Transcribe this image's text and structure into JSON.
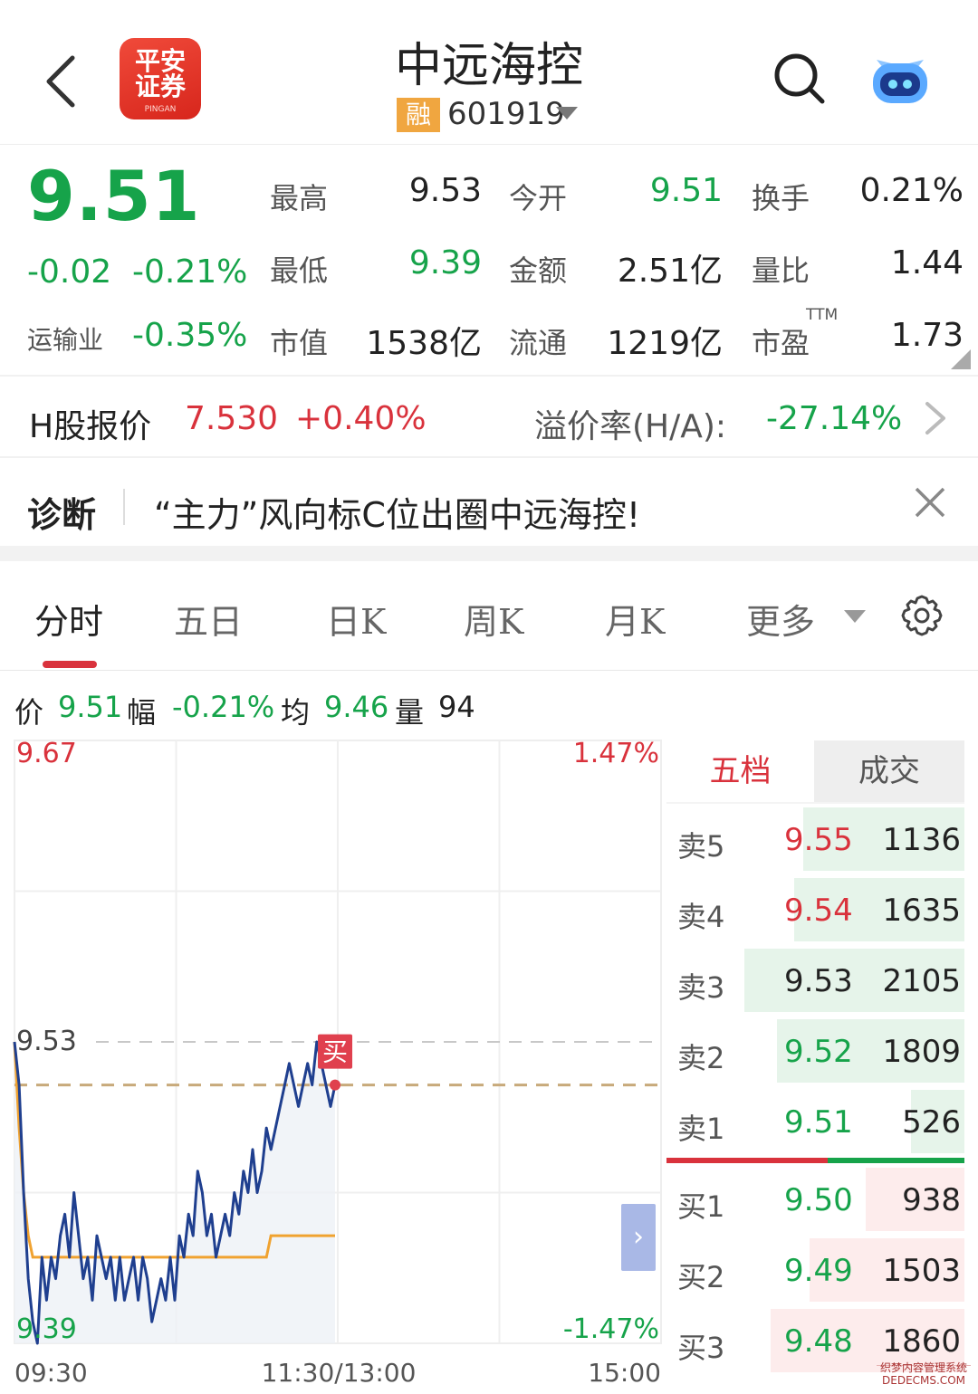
{
  "header": {
    "title": "中远海控",
    "badge": "融",
    "code": "601919",
    "logo_line1": "平安",
    "logo_line2": "证券",
    "logo_line3": "PINGAN",
    "icons": [
      "back-chevron-icon",
      "search-icon",
      "robot-assistant-icon",
      "dropdown-caret-icon"
    ]
  },
  "quote": {
    "price": "9.51",
    "change": "-0.02",
    "change_pct": "-0.21%",
    "industry": "运输业",
    "industry_pct": "-0.35%",
    "fields": {
      "high_label": "最高",
      "high": "9.53",
      "open_label": "今开",
      "open": "9.51",
      "turnover_label": "换手",
      "turnover": "0.21%",
      "low_label": "最低",
      "low": "9.39",
      "amount_label": "金额",
      "amount": "2.51亿",
      "vol_ratio_label": "量比",
      "vol_ratio": "1.44",
      "mcap_label": "市值",
      "mcap": "1538亿",
      "float_label": "流通",
      "float": "1219亿",
      "pe_label": "市盈",
      "pe_sup": "TTM",
      "pe": "1.73"
    }
  },
  "h_share": {
    "label": "H股报价",
    "price": "7.530",
    "change_pct": "+0.40%",
    "premium_label": "溢价率(H/A):",
    "premium": "-27.14%"
  },
  "diagnosis": {
    "label": "诊断",
    "text": "“主力”风向标C位出圈中远海控!"
  },
  "tabs": [
    "分时",
    "五日",
    "日K",
    "周K",
    "月K",
    "更多"
  ],
  "info_line": {
    "price_label": "价",
    "price": "9.51",
    "amp_label": "幅",
    "amp": "-0.21%",
    "avg_label": "均",
    "avg": "9.46",
    "vol_label": "量",
    "vol": "94"
  },
  "chart": {
    "y_max_label": "9.67",
    "y_max_pct": "1.47%",
    "y_min_label": "9.39",
    "y_min_pct": "-1.47%",
    "ref_label": "9.53",
    "buy_marker": "买",
    "x_labels": [
      "09:30",
      "11:30/13:00",
      "15:00"
    ],
    "expand_glyph": "›"
  },
  "chart_data": {
    "type": "line",
    "title": "",
    "ylim": [
      9.39,
      9.67
    ],
    "prev_close": 9.53,
    "x_ticks": [
      "09:30",
      "11:30/13:00",
      "15:00"
    ],
    "series": [
      {
        "values": [
          9.53,
          9.51,
          9.46,
          9.42,
          9.4,
          9.39,
          9.43,
          9.41,
          9.43,
          9.42,
          9.44,
          9.45,
          9.43,
          9.46,
          9.44,
          9.42,
          9.43,
          9.41,
          9.44,
          9.43,
          9.42,
          9.43,
          9.41,
          9.43,
          9.41,
          9.42,
          9.43,
          9.41,
          9.43,
          9.42,
          9.4,
          9.41,
          9.42,
          9.41,
          9.43,
          9.41,
          9.44,
          9.43,
          9.45,
          9.44,
          9.47,
          9.46,
          9.44,
          9.45,
          9.43,
          9.44,
          9.45,
          9.44,
          9.46,
          9.45,
          9.47,
          9.46,
          9.48,
          9.46,
          9.47,
          9.49,
          9.48,
          9.49,
          9.5,
          9.51,
          9.52,
          9.51,
          9.5,
          9.51,
          9.52,
          9.51,
          9.53,
          9.52,
          9.51,
          9.5,
          9.51
        ]
      },
      {
        "values": [
          9.53,
          9.49,
          9.46,
          9.44,
          9.43,
          9.43,
          9.43,
          9.43,
          9.43,
          9.43,
          9.43,
          9.43,
          9.43,
          9.43,
          9.43,
          9.43,
          9.43,
          9.43,
          9.43,
          9.43,
          9.43,
          9.43,
          9.43,
          9.43,
          9.43,
          9.43,
          9.43,
          9.43,
          9.43,
          9.43,
          9.43,
          9.43,
          9.43,
          9.43,
          9.43,
          9.43,
          9.43,
          9.43,
          9.43,
          9.43,
          9.43,
          9.43,
          9.43,
          9.43,
          9.43,
          9.43,
          9.43,
          9.43,
          9.43,
          9.43,
          9.43,
          9.43,
          9.43,
          9.43,
          9.43,
          9.43,
          9.44,
          9.44,
          9.44,
          9.44,
          9.44,
          9.44,
          9.44,
          9.44,
          9.44,
          9.44,
          9.44,
          9.44,
          9.44,
          9.44,
          9.44
        ]
      }
    ]
  },
  "order_book": {
    "tabs": [
      "五档",
      "成交"
    ],
    "asks": [
      {
        "label": "卖5",
        "price": "9.55",
        "vol": "1136",
        "color": "#d9323c",
        "share": 0.54
      },
      {
        "label": "卖4",
        "price": "9.54",
        "vol": "1635",
        "color": "#d9323c",
        "share": 0.57
      },
      {
        "label": "卖3",
        "price": "9.53",
        "vol": "2105",
        "color": "#222222",
        "share": 0.74
      },
      {
        "label": "卖2",
        "price": "9.52",
        "vol": "1809",
        "color": "#16a34a",
        "share": 0.63
      },
      {
        "label": "卖1",
        "price": "9.51",
        "vol": "526",
        "color": "#16a34a",
        "share": 0.18
      }
    ],
    "bids": [
      {
        "label": "买1",
        "price": "9.50",
        "vol": "938",
        "color": "#16a34a",
        "share": 0.33
      },
      {
        "label": "买2",
        "price": "9.49",
        "vol": "1503",
        "color": "#16a34a",
        "share": 0.52
      },
      {
        "label": "买3",
        "price": "9.48",
        "vol": "1860",
        "color": "#16a34a",
        "share": 0.65
      }
    ],
    "ask_bar_color": "#e6f4ea",
    "bid_bar_color": "#fdecec"
  },
  "watermark": {
    "line1": "织梦内容管理系统",
    "line2": "DEDECMS.COM"
  }
}
